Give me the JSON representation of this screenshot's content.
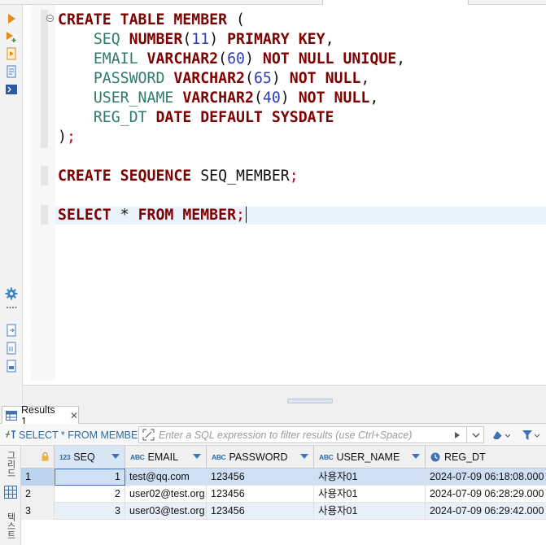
{
  "editor": {
    "lines": [
      [
        {
          "t": "CREATE",
          "c": "kw"
        },
        {
          "t": " "
        },
        {
          "t": "TABLE",
          "c": "kw"
        },
        {
          "t": " "
        },
        {
          "t": "MEMBER",
          "c": "kw"
        },
        {
          "t": " ("
        }
      ],
      [
        {
          "t": "    "
        },
        {
          "t": "SEQ",
          "c": "id"
        },
        {
          "t": " "
        },
        {
          "t": "NUMBER",
          "c": "kw"
        },
        {
          "t": "("
        },
        {
          "t": "11",
          "c": "num"
        },
        {
          "t": ") "
        },
        {
          "t": "PRIMARY",
          "c": "kw"
        },
        {
          "t": " "
        },
        {
          "t": "KEY",
          "c": "kw"
        },
        {
          "t": ","
        }
      ],
      [
        {
          "t": "    "
        },
        {
          "t": "EMAIL",
          "c": "id"
        },
        {
          "t": " "
        },
        {
          "t": "VARCHAR2",
          "c": "kw"
        },
        {
          "t": "("
        },
        {
          "t": "60",
          "c": "num"
        },
        {
          "t": ") "
        },
        {
          "t": "NOT",
          "c": "kw"
        },
        {
          "t": " "
        },
        {
          "t": "NULL",
          "c": "kw"
        },
        {
          "t": " "
        },
        {
          "t": "UNIQUE",
          "c": "kw"
        },
        {
          "t": ","
        }
      ],
      [
        {
          "t": "    "
        },
        {
          "t": "PASSWORD",
          "c": "id"
        },
        {
          "t": " "
        },
        {
          "t": "VARCHAR2",
          "c": "kw"
        },
        {
          "t": "("
        },
        {
          "t": "65",
          "c": "num"
        },
        {
          "t": ") "
        },
        {
          "t": "NOT",
          "c": "kw"
        },
        {
          "t": " "
        },
        {
          "t": "NULL",
          "c": "kw"
        },
        {
          "t": ","
        }
      ],
      [
        {
          "t": "    "
        },
        {
          "t": "USER_NAME",
          "c": "id"
        },
        {
          "t": " "
        },
        {
          "t": "VARCHAR2",
          "c": "kw"
        },
        {
          "t": "("
        },
        {
          "t": "40",
          "c": "num"
        },
        {
          "t": ") "
        },
        {
          "t": "NOT",
          "c": "kw"
        },
        {
          "t": " "
        },
        {
          "t": "NULL",
          "c": "kw"
        },
        {
          "t": ","
        }
      ],
      [
        {
          "t": "    "
        },
        {
          "t": "REG_DT",
          "c": "id"
        },
        {
          "t": " "
        },
        {
          "t": "DATE",
          "c": "kw"
        },
        {
          "t": " "
        },
        {
          "t": "DEFAULT",
          "c": "kw"
        },
        {
          "t": " "
        },
        {
          "t": "SYSDATE",
          "c": "kw"
        }
      ],
      [
        {
          "t": ")"
        },
        {
          "t": ";",
          "c": "semi"
        }
      ],
      [],
      [
        {
          "t": "CREATE",
          "c": "kw"
        },
        {
          "t": " "
        },
        {
          "t": "SEQUENCE",
          "c": "kw"
        },
        {
          "t": " SEQ_MEMBER"
        },
        {
          "t": ";",
          "c": "semi"
        }
      ],
      [],
      [
        {
          "t": "SELECT",
          "c": "kw"
        },
        {
          "t": " * "
        },
        {
          "t": "FROM",
          "c": "kw"
        },
        {
          "t": " "
        },
        {
          "t": "MEMBER",
          "c": "kw"
        },
        {
          "t": ";",
          "c": "semi"
        }
      ]
    ]
  },
  "results": {
    "tab_label": "Results 1",
    "close_glyph": "✕",
    "query_label": "SELECT * FROM MEMBER",
    "filter_placeholder": "Enter a SQL expression to filter results (use Ctrl+Space)",
    "side_tabs": [
      "그리드",
      "텍스트"
    ],
    "columns": [
      {
        "name": "SEQ",
        "type": "123"
      },
      {
        "name": "EMAIL",
        "type": "ABC"
      },
      {
        "name": "PASSWORD",
        "type": "ABC"
      },
      {
        "name": "USER_NAME",
        "type": "ABC"
      },
      {
        "name": "REG_DT",
        "type": "clock"
      }
    ],
    "rows": [
      {
        "num": "1",
        "cells": [
          "1",
          "test@qq.com",
          "123456",
          "사용자01",
          "2024-07-09 06:18:08.000"
        ]
      },
      {
        "num": "2",
        "cells": [
          "2",
          "user02@test.org",
          "123456",
          "사용자01",
          "2024-07-09 06:28:29.000"
        ]
      },
      {
        "num": "3",
        "cells": [
          "3",
          "user03@test.org",
          "123456",
          "사용자01",
          "2024-07-09 06:29:42.000"
        ]
      }
    ]
  },
  "colors": {
    "keyword": "#7f0000",
    "identifier": "#2e7d6b",
    "number": "#2c3fba",
    "accent": "#3d72b4"
  },
  "icons": {
    "toolbar": [
      "execute-statement-icon",
      "execute-in-new-tab-icon",
      "execute-script-icon",
      "explain-plan-icon",
      "output-console-icon",
      "settings-gear-icon",
      "export-icon",
      "open-file-icon",
      "save-script-icon"
    ],
    "results": [
      "results-tab-icon",
      "filter-history-icon",
      "erase-filter-icon",
      "apply-filter-icon"
    ]
  }
}
